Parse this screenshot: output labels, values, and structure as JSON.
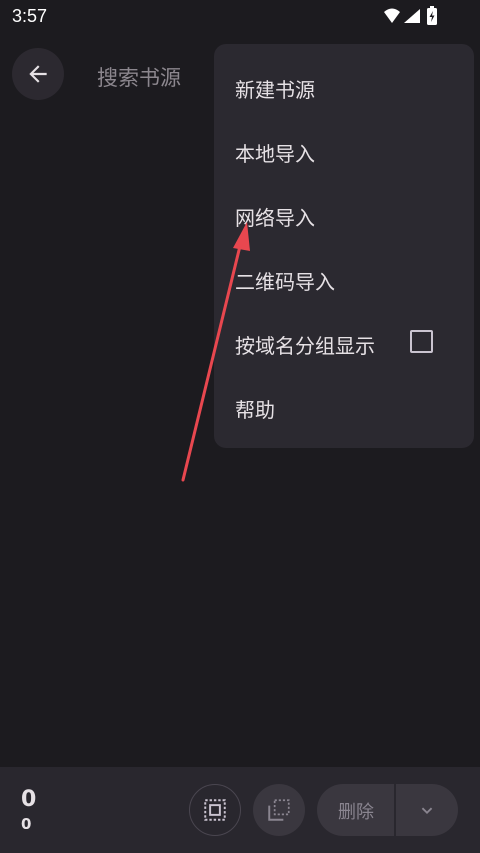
{
  "status_bar": {
    "time": "3:57",
    "icons": [
      "wifi-icon",
      "signal-icon",
      "battery-charging-icon"
    ]
  },
  "app_bar": {
    "back_icon": "arrow-left-icon",
    "search_placeholder": "搜索书源"
  },
  "overflow_menu": {
    "items": [
      {
        "label": "新建书源"
      },
      {
        "label": "本地导入"
      },
      {
        "label": "网络导入"
      },
      {
        "label": "二维码导入"
      },
      {
        "label": "按域名分组显示",
        "checkbox": false
      },
      {
        "label": "帮助"
      }
    ]
  },
  "annotation": {
    "color": "#e8474f"
  },
  "bottom_bar": {
    "selected_count": "0",
    "total_count": "0",
    "select_all_icon": "select-all-icon",
    "invert_selection_icon": "invert-selection-icon",
    "delete_label": "删除",
    "more_icon": "chevron-down-icon"
  },
  "colors": {
    "background": "#1c1b1f",
    "menu_surface": "#2b2930",
    "bottom_bar": "#29272e",
    "text_primary": "#e6e1e5",
    "text_hint": "#8c878e"
  }
}
